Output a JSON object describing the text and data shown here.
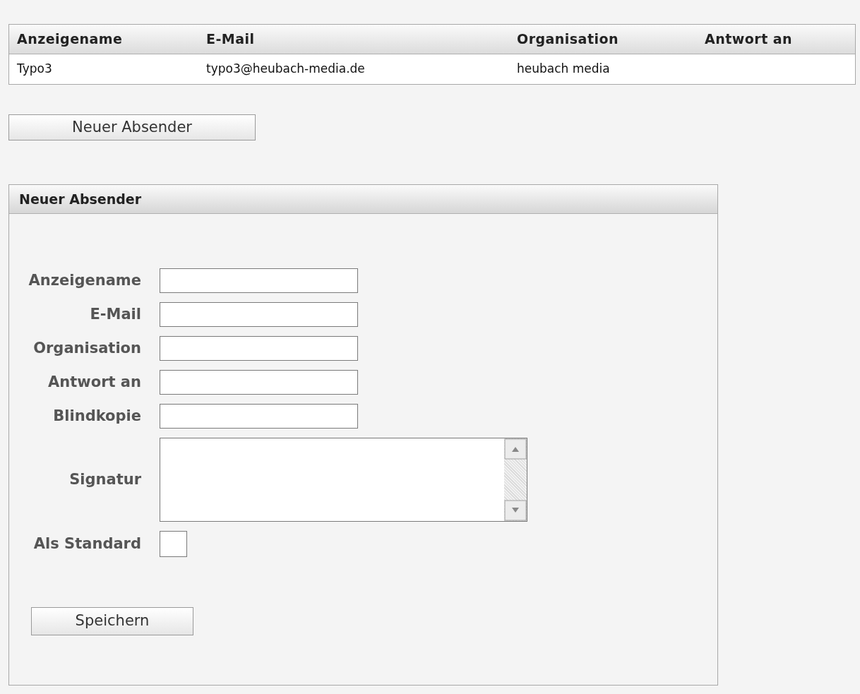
{
  "table": {
    "columns": [
      "Anzeigename",
      "E-Mail",
      "Organisation",
      "Antwort an"
    ],
    "rows": [
      [
        "Typo3",
        "typo3@heubach-media.de",
        "heubach media"
      ]
    ]
  },
  "new_sender_button": "Neuer Absender",
  "form": {
    "title": "Neuer Absender",
    "fields": [
      {
        "label": "Anzeigename",
        "kind": "text"
      },
      {
        "label": "E-Mail",
        "kind": "text"
      },
      {
        "label": "Organisation",
        "kind": "text"
      },
      {
        "label": "Antwort an",
        "kind": "text"
      },
      {
        "label": "Blindkopie",
        "kind": "text"
      },
      {
        "label": "Signatur",
        "kind": "textarea"
      },
      {
        "label": "Als Standard",
        "kind": "checkbox",
        "checked": false
      }
    ],
    "save_button": "Speichern"
  }
}
